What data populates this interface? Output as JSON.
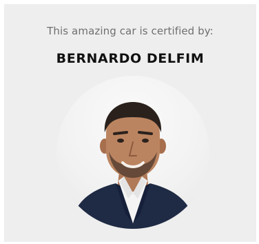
{
  "certification": {
    "subtitle": "This amazing car is certified by:",
    "certifier_name": "BERNARDO DELFIM"
  },
  "avatar": {
    "icon": "person-photo-avatar"
  },
  "colors": {
    "card_background": "#eeeeee",
    "subtitle_text": "#6f6f6f",
    "name_text": "#111111",
    "jacket": "#1f2a44",
    "shirt": "#f4f4f4"
  }
}
